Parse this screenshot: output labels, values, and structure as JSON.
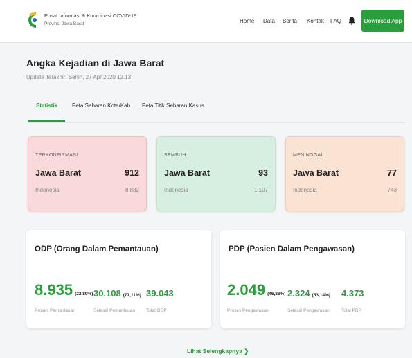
{
  "header": {
    "brand_title": "Pusat Informasi & Koordinasi COVID-19",
    "brand_sub": "Provinsi Jawa Barat",
    "nav": [
      "Home",
      "Data",
      "Berita",
      "Kontak",
      "FAQ"
    ],
    "download_label": "Download App",
    "accent": "#2a9d3c"
  },
  "page": {
    "title": "Angka Kejadian di Jawa Barat",
    "update": "Update Terakhir: Senin, 27 Apr 2020 12.13"
  },
  "tabs": [
    "Statistik",
    "Peta Sebaran Kota/Kab",
    "Peta Titik Sebaran Kasus"
  ],
  "stats": [
    {
      "label": "TERKONFIRMASI",
      "region": "Jawa Barat",
      "value": "912",
      "sub": "Indonesia",
      "sub_value": "8.882",
      "color": "#f9d9da"
    },
    {
      "label": "SEMBUH",
      "region": "Jawa Barat",
      "value": "93",
      "sub": "Indonesia",
      "sub_value": "1.107",
      "color": "#d6efe0"
    },
    {
      "label": "MENINGGAL",
      "region": "Jawa Barat",
      "value": "77",
      "sub": "Indonesia",
      "sub_value": "743",
      "color": "#fbe3d4"
    }
  ],
  "odp": {
    "title": "ODP (Orang Dalam Pemantauan)",
    "main_value": "8.935",
    "main_pct": "(22,89%)",
    "main_caption": "Proses Pemantauan",
    "second_value": "30.108",
    "second_pct": "(77,11%)",
    "second_caption": "Selesai Pemantauan",
    "total_value": "39.043",
    "total_caption": "Total ODP"
  },
  "pdp": {
    "title": "PDP (Pasien Dalam Pengawasan)",
    "main_value": "2.049",
    "main_pct": "(46,86%)",
    "main_caption": "Proses Pengawasan",
    "second_value": "2.324",
    "second_pct": "(53,14%)",
    "second_caption": "Selesai Pengawasan",
    "total_value": "4.373",
    "total_caption": "Total PDP"
  },
  "more_link": "Lihat Selengkapnya ❯"
}
